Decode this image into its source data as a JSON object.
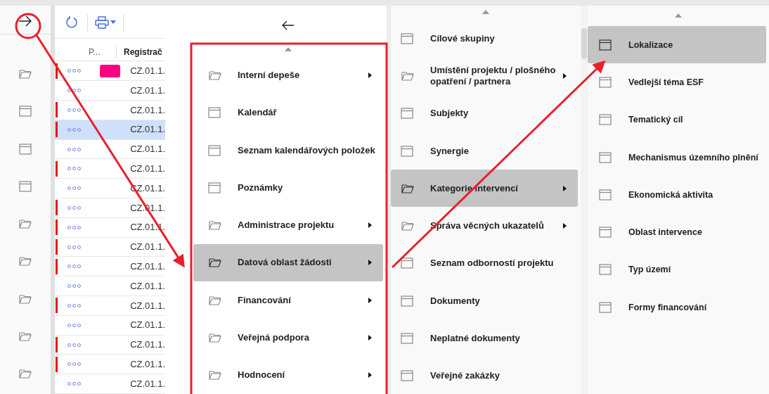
{
  "sidebar": {
    "items": [
      {
        "kind": "folder"
      },
      {
        "kind": "window"
      },
      {
        "kind": "window"
      },
      {
        "kind": "window"
      },
      {
        "kind": "folder"
      },
      {
        "kind": "folder"
      },
      {
        "kind": "folder"
      },
      {
        "kind": "folder"
      },
      {
        "kind": "folder"
      }
    ]
  },
  "table": {
    "columns": [
      "P...",
      "Registrač"
    ],
    "rows": [
      {
        "flagged": true,
        "selected": false,
        "color": "#ff0080",
        "number": "CZ.01.1."
      },
      {
        "flagged": false,
        "selected": false,
        "number": "CZ.01.1."
      },
      {
        "flagged": true,
        "selected": false,
        "number": "CZ.01.1."
      },
      {
        "flagged": true,
        "selected": true,
        "number": "CZ.01.1."
      },
      {
        "flagged": false,
        "selected": false,
        "number": "CZ.01.1."
      },
      {
        "flagged": true,
        "selected": false,
        "number": "CZ.01.1."
      },
      {
        "flagged": false,
        "selected": false,
        "number": "CZ.01.1."
      },
      {
        "flagged": true,
        "selected": false,
        "number": "CZ.01.1."
      },
      {
        "flagged": true,
        "selected": false,
        "number": "CZ.01.1."
      },
      {
        "flagged": true,
        "selected": false,
        "number": "CZ.01.1."
      },
      {
        "flagged": true,
        "selected": false,
        "number": "CZ.01.1."
      },
      {
        "flagged": false,
        "selected": false,
        "number": "CZ.01.1."
      },
      {
        "flagged": true,
        "selected": false,
        "number": "CZ.01.1."
      },
      {
        "flagged": false,
        "selected": false,
        "number": "CZ.01.1."
      },
      {
        "flagged": true,
        "selected": false,
        "number": "CZ.01.1."
      },
      {
        "flagged": true,
        "selected": false,
        "number": "CZ.01.1."
      },
      {
        "flagged": false,
        "selected": false,
        "number": "CZ.01.1."
      }
    ]
  },
  "menus": [
    {
      "items": [
        {
          "kind": "folder",
          "label": "Interní depeše",
          "submenu": true,
          "selected": false
        },
        {
          "kind": "window",
          "label": "Kalendář",
          "submenu": false,
          "selected": false
        },
        {
          "kind": "window",
          "label": "Seznam kalendářových položek",
          "submenu": false,
          "selected": false
        },
        {
          "kind": "window",
          "label": "Poznámky",
          "submenu": false,
          "selected": false
        },
        {
          "kind": "folder",
          "label": "Administrace projektu",
          "submenu": true,
          "selected": false
        },
        {
          "kind": "folder",
          "label": "Datová oblast žádosti",
          "submenu": true,
          "selected": true
        },
        {
          "kind": "folder",
          "label": "Financování",
          "submenu": true,
          "selected": false
        },
        {
          "kind": "folder",
          "label": "Veřejná podpora",
          "submenu": true,
          "selected": false
        },
        {
          "kind": "folder",
          "label": "Hodnocení",
          "submenu": true,
          "selected": false
        }
      ]
    },
    {
      "items": [
        {
          "kind": "window",
          "label": "Cílové skupiny",
          "submenu": false,
          "selected": false
        },
        {
          "kind": "folder",
          "label": "Umístění projektu / plošného opatření / partnera",
          "submenu": true,
          "selected": false
        },
        {
          "kind": "window",
          "label": "Subjekty",
          "submenu": false,
          "selected": false
        },
        {
          "kind": "window",
          "label": "Synergie",
          "submenu": false,
          "selected": false
        },
        {
          "kind": "folder",
          "label": "Kategorie intervencí",
          "submenu": true,
          "selected": true
        },
        {
          "kind": "folder",
          "label": "Správa věcných ukazatelů",
          "submenu": true,
          "selected": false
        },
        {
          "kind": "window",
          "label": "Seznam odborností projektu",
          "submenu": false,
          "selected": false
        },
        {
          "kind": "window",
          "label": "Dokumenty",
          "submenu": false,
          "selected": false
        },
        {
          "kind": "window",
          "label": "Neplatné dokumenty",
          "submenu": false,
          "selected": false
        },
        {
          "kind": "window",
          "label": "Veřejné zakázky",
          "submenu": false,
          "selected": false
        }
      ]
    },
    {
      "items": [
        {
          "kind": "window",
          "label": "Lokalizace",
          "submenu": false,
          "selected": true
        },
        {
          "kind": "window",
          "label": "Vedlejší téma ESF",
          "submenu": false,
          "selected": false
        },
        {
          "kind": "window",
          "label": "Tematický cíl",
          "submenu": false,
          "selected": false
        },
        {
          "kind": "window",
          "label": "Mechanismus územního plnění",
          "submenu": false,
          "selected": false
        },
        {
          "kind": "window",
          "label": "Ekonomická aktivita",
          "submenu": false,
          "selected": false
        },
        {
          "kind": "window",
          "label": "Oblast intervence",
          "submenu": false,
          "selected": false
        },
        {
          "kind": "window",
          "label": "Typ území",
          "submenu": false,
          "selected": false
        },
        {
          "kind": "window",
          "label": "Formy financování",
          "submenu": false,
          "selected": false
        }
      ]
    }
  ]
}
